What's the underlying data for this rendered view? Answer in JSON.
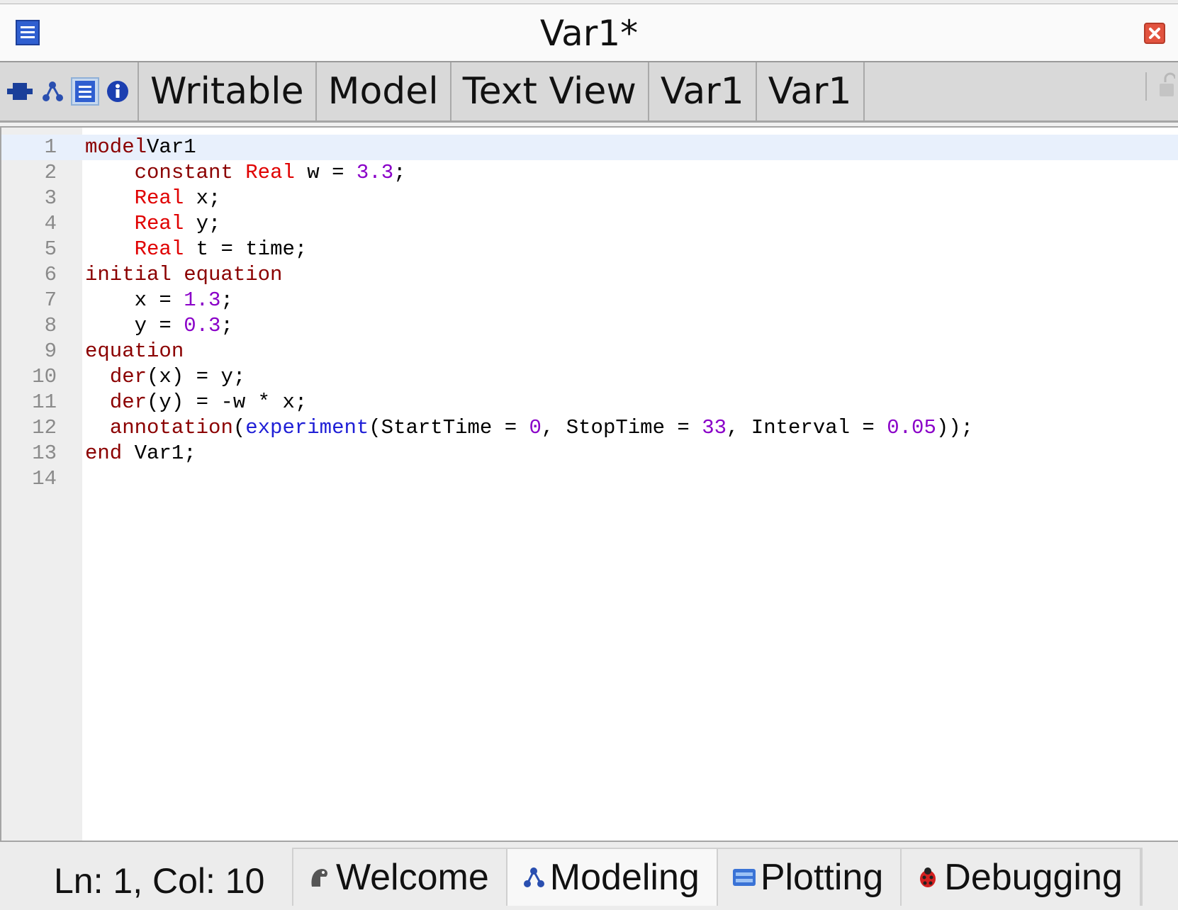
{
  "window": {
    "title": "Var1*"
  },
  "toolbar": {
    "icons": [
      {
        "name": "diagram-view-icon",
        "active": false
      },
      {
        "name": "icon-view-icon",
        "active": false
      },
      {
        "name": "text-view-icon",
        "active": true
      },
      {
        "name": "documentation-view-icon",
        "active": false
      }
    ],
    "cells": [
      "Writable",
      "Model",
      "Text View",
      "Var1",
      "Var1"
    ]
  },
  "editor": {
    "current_line": 1,
    "lines": [
      {
        "n": "1",
        "tokens": [
          [
            "kw",
            "model"
          ],
          [
            "",
            "Var1"
          ]
        ]
      },
      {
        "n": "2",
        "tokens": [
          [
            "",
            "    "
          ],
          [
            "kw",
            "constant"
          ],
          [
            "",
            " "
          ],
          [
            "ty",
            "Real"
          ],
          [
            "",
            " w = "
          ],
          [
            "num",
            "3.3"
          ],
          [
            "",
            ";"
          ]
        ]
      },
      {
        "n": "3",
        "tokens": [
          [
            "",
            "    "
          ],
          [
            "ty",
            "Real"
          ],
          [
            "",
            " x;"
          ]
        ]
      },
      {
        "n": "4",
        "tokens": [
          [
            "",
            "    "
          ],
          [
            "ty",
            "Real"
          ],
          [
            "",
            " y;"
          ]
        ]
      },
      {
        "n": "5",
        "tokens": [
          [
            "",
            "    "
          ],
          [
            "ty",
            "Real"
          ],
          [
            "",
            " t = time;"
          ]
        ]
      },
      {
        "n": "6",
        "tokens": [
          [
            "kw",
            "initial equation"
          ]
        ]
      },
      {
        "n": "7",
        "tokens": [
          [
            "",
            "    x = "
          ],
          [
            "num",
            "1.3"
          ],
          [
            "",
            ";"
          ]
        ]
      },
      {
        "n": "8",
        "tokens": [
          [
            "",
            "    y = "
          ],
          [
            "num",
            "0.3"
          ],
          [
            "",
            ";"
          ]
        ]
      },
      {
        "n": "9",
        "tokens": [
          [
            "kw",
            "equation"
          ]
        ]
      },
      {
        "n": "10",
        "tokens": [
          [
            "",
            "  "
          ],
          [
            "kw",
            "der"
          ],
          [
            "",
            "(x) = y;"
          ]
        ]
      },
      {
        "n": "11",
        "tokens": [
          [
            "",
            "  "
          ],
          [
            "kw",
            "der"
          ],
          [
            "",
            "(y) = -w * x;"
          ]
        ]
      },
      {
        "n": "12",
        "tokens": [
          [
            "",
            "  "
          ],
          [
            "kw",
            "annotation"
          ],
          [
            "",
            "("
          ],
          [
            "fn",
            "experiment"
          ],
          [
            "",
            "(StartTime = "
          ],
          [
            "num",
            "0"
          ],
          [
            "",
            ", StopTime = "
          ],
          [
            "num",
            "33"
          ],
          [
            "",
            ", Interval = "
          ],
          [
            "num",
            "0.05"
          ],
          [
            "",
            "));"
          ]
        ]
      },
      {
        "n": "13",
        "tokens": [
          [
            "kw",
            "end"
          ],
          [
            "",
            " Var1;"
          ]
        ]
      },
      {
        "n": "14",
        "tokens": []
      }
    ]
  },
  "status": {
    "cursor": "Ln: 1, Col: 10"
  },
  "perspectives": [
    {
      "label": "Welcome",
      "icon": "welcome-icon",
      "active": false
    },
    {
      "label": "Modeling",
      "icon": "modeling-icon",
      "active": true
    },
    {
      "label": "Plotting",
      "icon": "plotting-icon",
      "active": false
    },
    {
      "label": "Debugging",
      "icon": "debugging-icon",
      "active": false
    }
  ],
  "colors": {
    "keyword": "#8b0000",
    "type": "#e00000",
    "number": "#8a00c8",
    "function": "#1f1fd6",
    "line_highlight": "#e8f0fc"
  }
}
